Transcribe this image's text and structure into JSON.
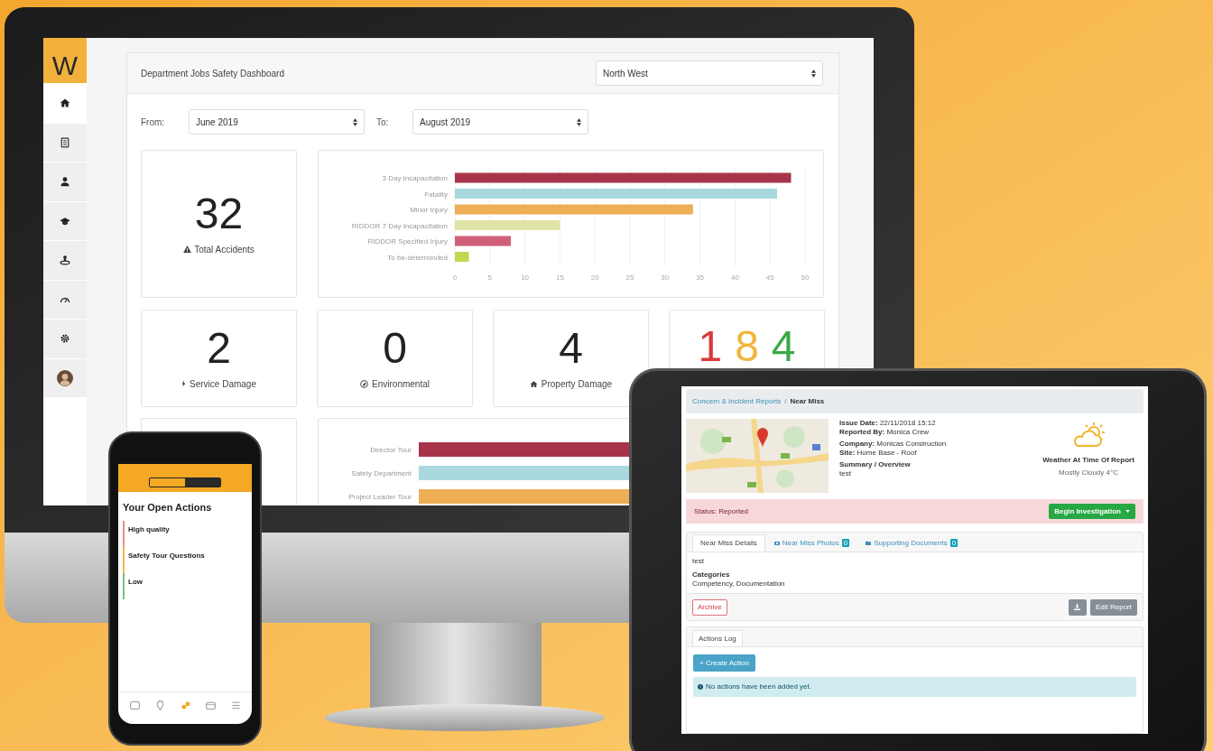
{
  "monitor": {
    "sidebar": {
      "logo": "W",
      "items": [
        {
          "selected": true
        },
        {
          "selected": false
        },
        {
          "selected": false
        },
        {
          "selected": false
        },
        {
          "selected": false
        },
        {
          "selected": false
        },
        {
          "selected": false
        },
        {
          "selected": false
        }
      ]
    },
    "dashboard": {
      "title": "Department Jobs Safety Dashboard",
      "region": "North West",
      "from_label": "From:",
      "from_value": "June 2019",
      "to_label": "To:",
      "to_value": "August 2019",
      "total": {
        "value": "32",
        "label": "Total Accidents"
      },
      "chart_data": {
        "type": "bar",
        "orientation": "horizontal",
        "categories": [
          "3 Day Incapacitation",
          "Fatality",
          "Minor Injury",
          "RIDDOR 7 Day Incapacitation",
          "RIDDOR Specified Injury",
          "To be-determinded"
        ],
        "values": [
          48,
          46,
          34,
          15,
          8,
          2
        ],
        "grid": true,
        "colors": [
          "#a8344a",
          "#a9d8df",
          "#eeae55",
          "#dfe3a6",
          "#d0607a",
          "#c4d64f"
        ],
        "xlim": [
          0,
          50
        ],
        "xticks": [
          0,
          5,
          10,
          15,
          20,
          25,
          30,
          35,
          40,
          45,
          50
        ]
      },
      "stats": [
        {
          "value": "2",
          "label": "Service Damage"
        },
        {
          "value": "0",
          "label": "Environmental"
        },
        {
          "value": "4",
          "label": "Property Damage"
        }
      ],
      "scores": [
        {
          "value": "1",
          "color": "#d83a3a"
        },
        {
          "value": "8",
          "color": "#f0b53c"
        },
        {
          "value": "4",
          "color": "#3aa847"
        }
      ],
      "tour_chart": {
        "bars": [
          {
            "label": "Director Tour",
            "color": "#a8344a"
          },
          {
            "label": "Safety Department",
            "color": "#a9d8df"
          },
          {
            "label": "Project Leader Tour",
            "color": "#eeae55"
          }
        ]
      }
    }
  },
  "tablet": {
    "breadcrumb": {
      "link": "Concern & Incident Reports",
      "separator": "/",
      "current": "Near Miss"
    },
    "details": [
      "**Issue Date:** 22/11/2018 15:12",
      "**Reported By:** Monica Crew",
      "**Company:** Monicas Construction",
      "**Site:** Home Base - Roof"
    ],
    "summary_label": "Summary / Overview",
    "summary": "test",
    "weather": {
      "title": "Weather At Time Of Report",
      "reading": "Mostly Cloudy 4°C"
    },
    "status": "Status: Reported",
    "begin_button": "Begin Investigation",
    "tabs": [
      {
        "label": "Near Miss Details",
        "selected": true
      },
      {
        "label": "Near Miss Photos",
        "badge": "0",
        "selected": false
      },
      {
        "label": "Supporting Documents",
        "badge": "0",
        "selected": false
      }
    ],
    "body_text": "test",
    "categories_label": "Categories",
    "categories": "Competency, Documentation",
    "archive_button": "Archive",
    "edit_button": "Edit Report",
    "log_tab": "Actions Log",
    "create_button": "+ Create Action",
    "empty_message": "No actions have been added yet."
  },
  "phone": {
    "title": "Your Open Actions",
    "actions": [
      {
        "title": "High quality",
        "color": "#ef8b86"
      },
      {
        "title": "Safety Tour Questions",
        "color": "#f2b84b"
      },
      {
        "title": "Low",
        "color": "#79c27a"
      }
    ],
    "tab_bar": [
      {
        "selected": false
      },
      {
        "selected": false
      },
      {
        "selected": true
      },
      {
        "selected": false
      },
      {
        "selected": false
      }
    ]
  }
}
